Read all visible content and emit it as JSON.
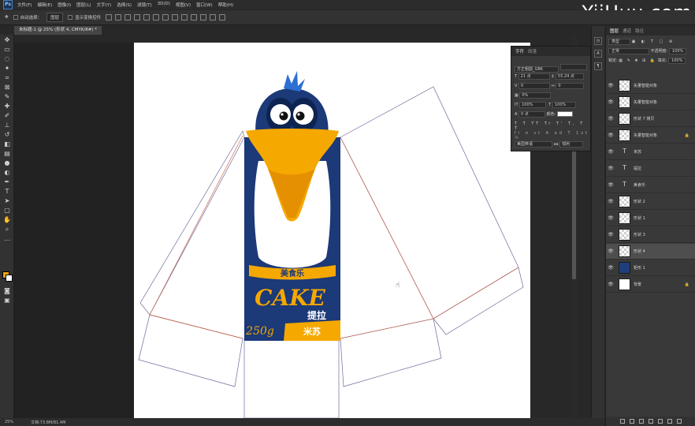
{
  "app": {
    "logo": "Ps"
  },
  "menu": [
    "文件(F)",
    "编辑(E)",
    "图像(I)",
    "图层(L)",
    "文字(Y)",
    "选择(S)",
    "滤镜(T)",
    "3D(D)",
    "视图(V)",
    "窗口(W)",
    "帮助(H)"
  ],
  "watermark": "YiiHuu.com",
  "options": {
    "auto_select": "自动选择：",
    "target": "图层",
    "transform_controls": "显示变换控件"
  },
  "document": {
    "tab": "未标题-1 @ 25% (形状 4, CMYK/8#) *"
  },
  "status": {
    "zoom": "25%",
    "doc": "文档:73.8M/81.4M"
  },
  "colors": {
    "foreground": "#f5a300",
    "background": "#ffffff"
  },
  "character_panel": {
    "tabs": [
      "字符",
      "段落"
    ],
    "font": "方正粗圆_GBK",
    "size": "21 点",
    "leading": "55.24 点",
    "kerning": "0",
    "tracking": "0",
    "scale": "0%",
    "vscale": "100%",
    "hscale": "100%",
    "baseline": "0 点",
    "color_label": "颜色:",
    "language": "美国英语",
    "aa": "锐利",
    "style_buttons": [
      "T",
      "T",
      "TT",
      "Tr",
      "T'",
      "T,",
      "T",
      "T"
    ]
  },
  "layers_panel": {
    "tabs": [
      "图层",
      "通道",
      "路径"
    ],
    "kind": "类型",
    "blend_mode": "正常",
    "opacity_label": "不透明度:",
    "opacity": "100%",
    "lock_label": "锁定:",
    "fill_label": "填充:",
    "fill": "100%",
    "layers": [
      {
        "name": "矢量智能对象",
        "thumb": "checker",
        "visible": "👁",
        "lock": ""
      },
      {
        "name": "矢量智能对象",
        "thumb": "checker",
        "visible": "👁",
        "lock": ""
      },
      {
        "name": "形状 7 拷贝",
        "thumb": "checker",
        "visible": "👁",
        "lock": ""
      },
      {
        "name": "矢量智能对象",
        "thumb": "checker",
        "visible": "👁",
        "lock": "🔒"
      },
      {
        "name": "米苏",
        "thumb": "T",
        "visible": "👁",
        "lock": ""
      },
      {
        "name": "提拉",
        "thumb": "T",
        "visible": "👁",
        "lock": ""
      },
      {
        "name": "美食乐",
        "thumb": "T",
        "visible": "👁",
        "lock": ""
      },
      {
        "name": "形状 2",
        "thumb": "checker",
        "visible": "👁",
        "lock": ""
      },
      {
        "name": "形状 1",
        "thumb": "checker",
        "visible": "👁",
        "lock": ""
      },
      {
        "name": "形状 3",
        "thumb": "checker",
        "visible": "👁",
        "lock": ""
      },
      {
        "name": "形状 4",
        "thumb": "checker",
        "visible": "👁",
        "lock": ""
      },
      {
        "name": "矩形 1",
        "thumb": "dark",
        "visible": "👁",
        "lock": ""
      },
      {
        "name": "背景",
        "thumb": "white",
        "visible": "👁",
        "lock": "🔒"
      }
    ]
  },
  "artwork": {
    "band_text": "美食乐",
    "brand": "CAKE",
    "product": "提拉",
    "product2": "米苏",
    "weight": "250g"
  }
}
